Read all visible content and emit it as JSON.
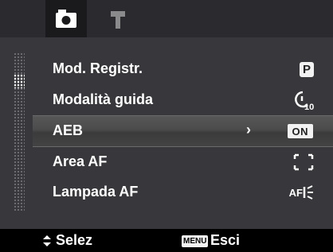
{
  "tabs": [
    {
      "icon": "camera-icon",
      "active": true
    },
    {
      "icon": "hammer-icon",
      "active": false
    }
  ],
  "menu": {
    "items": [
      {
        "label": "Mod. Registr.",
        "value_icon": "program-mode-icon",
        "value_text": "P"
      },
      {
        "label": "Modalità guida",
        "value_icon": "self-timer-10s-icon",
        "value_text": "10"
      },
      {
        "label": "AEB",
        "value_icon": "on-badge-icon",
        "value_text": "ON",
        "selected": true
      },
      {
        "label": "Area AF",
        "value_icon": "af-area-bracket-icon"
      },
      {
        "label": "Lampada AF",
        "value_icon": "af-lamp-icon",
        "value_text": "AF"
      }
    ]
  },
  "hints": {
    "select_label": "Selez",
    "menu_key": "MENU",
    "exit_label": "Esci"
  },
  "colors": {
    "topbar": "#2b2a2e",
    "panel": "#38373b",
    "selected_row": "#4b4b4b",
    "text": "#ffffff"
  }
}
